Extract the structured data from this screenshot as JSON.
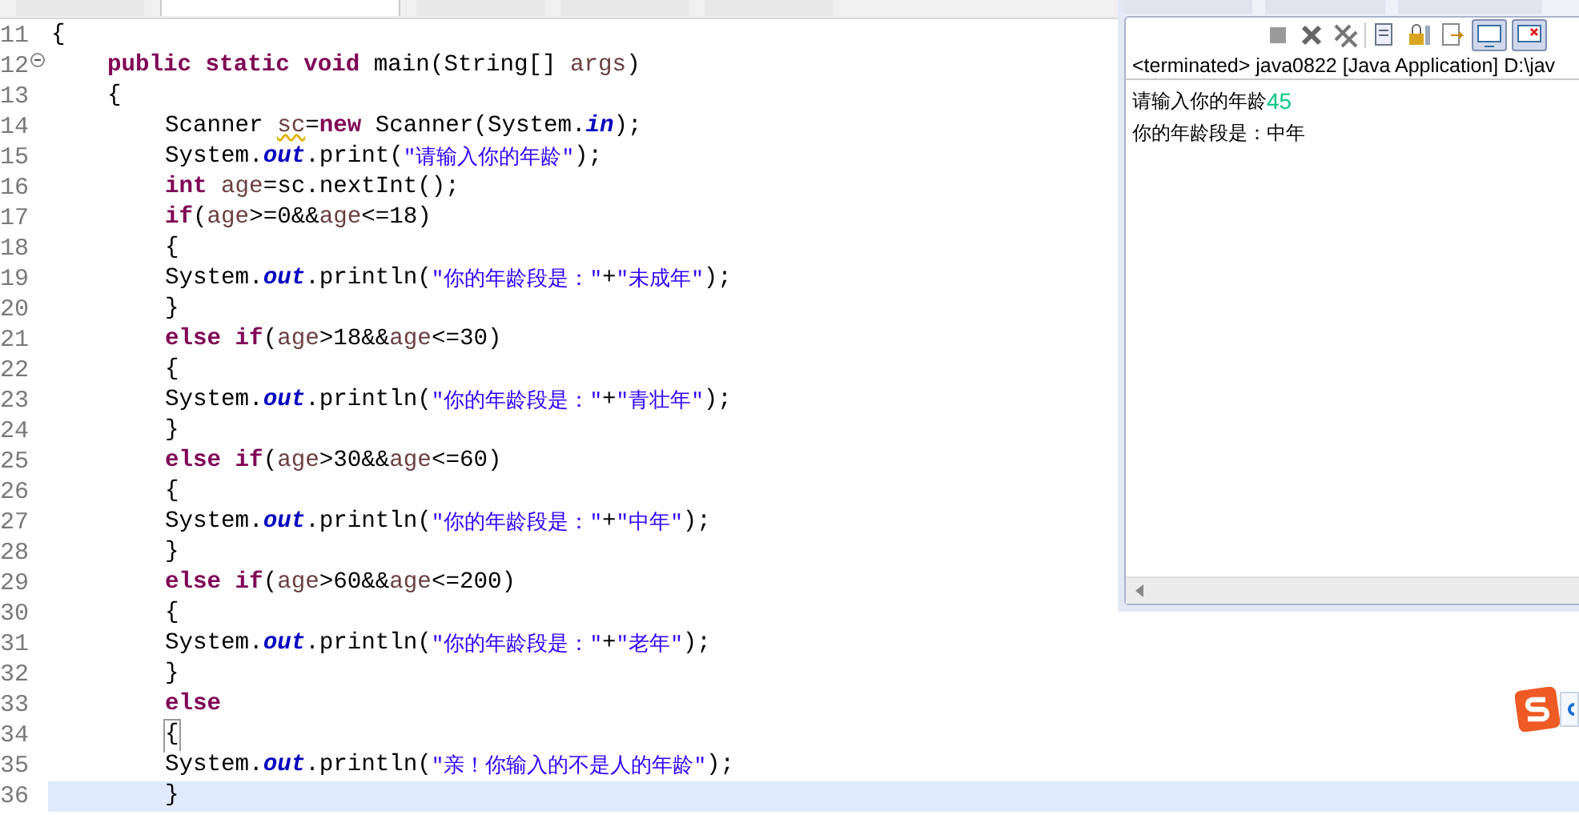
{
  "editor_tabs": [
    {
      "selected": false
    },
    {
      "selected": true
    },
    {
      "selected": false
    },
    {
      "selected": false
    },
    {
      "selected": false
    }
  ],
  "editor": {
    "lines": [
      {
        "num": "11",
        "current": false,
        "fold": false,
        "tokens": [
          {
            "kind": "plain",
            "text": "{"
          }
        ],
        "children": [
          {
            "num": "12",
            "current": false,
            "fold": true,
            "tokens": [
              {
                "kind": "kw",
                "text": "public"
              },
              {
                "kind": "kw",
                "text": " static"
              },
              {
                "kind": "kw",
                "text": " void"
              },
              {
                "kind": "plain",
                "text": " main(String[] "
              },
              {
                "kind": "var",
                "text": "args"
              },
              {
                "kind": "plain",
                "text": ")"
              }
            ]
          },
          {
            "num": "13",
            "current": false,
            "fold": false,
            "tokens": [
              {
                "kind": "plain",
                "text": "{"
              }
            ],
            "children": [
              {
                "num": "14",
                "current": false,
                "fold": false,
                "tokens": [
                  {
                    "kind": "plain",
                    "text": "Scanner "
                  },
                  {
                    "kind": "warn",
                    "text": "sc"
                  },
                  {
                    "kind": "plain",
                    "text": "="
                  },
                  {
                    "kind": "kw",
                    "text": "new"
                  },
                  {
                    "kind": "plain",
                    "text": " Scanner(System."
                  },
                  {
                    "kind": "field",
                    "text": "in"
                  },
                  {
                    "kind": "plain",
                    "text": ");"
                  }
                ]
              },
              {
                "num": "15",
                "current": false,
                "fold": false,
                "tokens": [
                  {
                    "kind": "plain",
                    "text": "System."
                  },
                  {
                    "kind": "field",
                    "text": "out"
                  },
                  {
                    "kind": "plain",
                    "text": ".print("
                  },
                  {
                    "kind": "str",
                    "text": "\"请输入你的年龄\""
                  },
                  {
                    "kind": "plain",
                    "text": ");"
                  }
                ]
              },
              {
                "num": "16",
                "current": false,
                "fold": false,
                "tokens": [
                  {
                    "kind": "kw",
                    "text": "int"
                  },
                  {
                    "kind": "var",
                    "text": " age"
                  },
                  {
                    "kind": "plain",
                    "text": "=sc.nextInt();"
                  }
                ]
              },
              {
                "num": "17",
                "current": false,
                "fold": false,
                "tokens": [
                  {
                    "kind": "kw",
                    "text": "if"
                  },
                  {
                    "kind": "plain",
                    "text": "("
                  },
                  {
                    "kind": "var",
                    "text": "age"
                  },
                  {
                    "kind": "plain",
                    "text": ">=0&&"
                  },
                  {
                    "kind": "var",
                    "text": "age"
                  },
                  {
                    "kind": "plain",
                    "text": "<=18)"
                  }
                ]
              },
              {
                "num": "18",
                "current": false,
                "fold": false,
                "tokens": [
                  {
                    "kind": "plain",
                    "text": "{"
                  }
                ]
              },
              {
                "num": "19",
                "current": false,
                "fold": false,
                "tokens": [
                  {
                    "kind": "plain",
                    "text": "System."
                  },
                  {
                    "kind": "field",
                    "text": "out"
                  },
                  {
                    "kind": "plain",
                    "text": ".println("
                  },
                  {
                    "kind": "str",
                    "text": "\"你的年龄段是：\""
                  },
                  {
                    "kind": "plain",
                    "text": "+"
                  },
                  {
                    "kind": "str",
                    "text": "\"未成年\""
                  },
                  {
                    "kind": "plain",
                    "text": ");"
                  }
                ]
              },
              {
                "num": "20",
                "current": false,
                "fold": false,
                "tokens": [
                  {
                    "kind": "plain",
                    "text": "}"
                  }
                ]
              },
              {
                "num": "21",
                "current": false,
                "fold": false,
                "tokens": [
                  {
                    "kind": "kw",
                    "text": "else"
                  },
                  {
                    "kind": "kw",
                    "text": " if"
                  },
                  {
                    "kind": "plain",
                    "text": "("
                  },
                  {
                    "kind": "var",
                    "text": "age"
                  },
                  {
                    "kind": "plain",
                    "text": ">18&&"
                  },
                  {
                    "kind": "var",
                    "text": "age"
                  },
                  {
                    "kind": "plain",
                    "text": "<=30)"
                  }
                ]
              },
              {
                "num": "22",
                "current": false,
                "fold": false,
                "tokens": [
                  {
                    "kind": "plain",
                    "text": "{"
                  }
                ]
              },
              {
                "num": "23",
                "current": false,
                "fold": false,
                "tokens": [
                  {
                    "kind": "plain",
                    "text": "System."
                  },
                  {
                    "kind": "field",
                    "text": "out"
                  },
                  {
                    "kind": "plain",
                    "text": ".println("
                  },
                  {
                    "kind": "str",
                    "text": "\"你的年龄段是：\""
                  },
                  {
                    "kind": "plain",
                    "text": "+"
                  },
                  {
                    "kind": "str",
                    "text": "\"青壮年\""
                  },
                  {
                    "kind": "plain",
                    "text": ");"
                  }
                ]
              },
              {
                "num": "24",
                "current": false,
                "fold": false,
                "tokens": [
                  {
                    "kind": "plain",
                    "text": "}"
                  }
                ]
              },
              {
                "num": "25",
                "current": false,
                "fold": false,
                "tokens": [
                  {
                    "kind": "kw",
                    "text": "else"
                  },
                  {
                    "kind": "kw",
                    "text": " if"
                  },
                  {
                    "kind": "plain",
                    "text": "("
                  },
                  {
                    "kind": "var",
                    "text": "age"
                  },
                  {
                    "kind": "plain",
                    "text": ">30&&"
                  },
                  {
                    "kind": "var",
                    "text": "age"
                  },
                  {
                    "kind": "plain",
                    "text": "<=60)"
                  }
                ]
              },
              {
                "num": "26",
                "current": false,
                "fold": false,
                "tokens": [
                  {
                    "kind": "plain",
                    "text": "{"
                  }
                ]
              },
              {
                "num": "27",
                "current": false,
                "fold": false,
                "tokens": [
                  {
                    "kind": "plain",
                    "text": "System."
                  },
                  {
                    "kind": "field",
                    "text": "out"
                  },
                  {
                    "kind": "plain",
                    "text": ".println("
                  },
                  {
                    "kind": "str",
                    "text": "\"你的年龄段是：\""
                  },
                  {
                    "kind": "plain",
                    "text": "+"
                  },
                  {
                    "kind": "str",
                    "text": "\"中年\""
                  },
                  {
                    "kind": "plain",
                    "text": ");"
                  }
                ]
              },
              {
                "num": "28",
                "current": false,
                "fold": false,
                "tokens": [
                  {
                    "kind": "plain",
                    "text": "}"
                  }
                ]
              },
              {
                "num": "29",
                "current": false,
                "fold": false,
                "tokens": [
                  {
                    "kind": "kw",
                    "text": "else"
                  },
                  {
                    "kind": "kw",
                    "text": " if"
                  },
                  {
                    "kind": "plain",
                    "text": "("
                  },
                  {
                    "kind": "var",
                    "text": "age"
                  },
                  {
                    "kind": "plain",
                    "text": ">60&&"
                  },
                  {
                    "kind": "var",
                    "text": "age"
                  },
                  {
                    "kind": "plain",
                    "text": "<=200)"
                  }
                ]
              },
              {
                "num": "30",
                "current": false,
                "fold": false,
                "tokens": [
                  {
                    "kind": "plain",
                    "text": "{"
                  }
                ]
              },
              {
                "num": "31",
                "current": false,
                "fold": false,
                "tokens": [
                  {
                    "kind": "plain",
                    "text": "System."
                  },
                  {
                    "kind": "field",
                    "text": "out"
                  },
                  {
                    "kind": "plain",
                    "text": ".println("
                  },
                  {
                    "kind": "str",
                    "text": "\"你的年龄段是：\""
                  },
                  {
                    "kind": "plain",
                    "text": "+"
                  },
                  {
                    "kind": "str",
                    "text": "\"老年\""
                  },
                  {
                    "kind": "plain",
                    "text": ");"
                  }
                ]
              },
              {
                "num": "32",
                "current": false,
                "fold": false,
                "tokens": [
                  {
                    "kind": "plain",
                    "text": "}"
                  }
                ]
              },
              {
                "num": "33",
                "current": false,
                "fold": false,
                "tokens": [
                  {
                    "kind": "kw",
                    "text": "else"
                  }
                ]
              },
              {
                "num": "34",
                "current": false,
                "fold": false,
                "tokens": [
                  {
                    "kind": "bracket",
                    "text": "{"
                  }
                ]
              },
              {
                "num": "35",
                "current": false,
                "fold": false,
                "tokens": [
                  {
                    "kind": "plain",
                    "text": "System."
                  },
                  {
                    "kind": "field",
                    "text": "out"
                  },
                  {
                    "kind": "plain",
                    "text": ".println("
                  },
                  {
                    "kind": "str",
                    "text": "\"亲！你输入的不是人的年龄\""
                  },
                  {
                    "kind": "plain",
                    "text": ");"
                  }
                ]
              },
              {
                "num": "36",
                "current": true,
                "fold": false,
                "tokens": [
                  {
                    "kind": "plain",
                    "text": "}"
                  }
                ]
              }
            ]
          }
        ]
      }
    ]
  },
  "console": {
    "header": "<terminated> java0822 [Java Application] D:\\jav",
    "output": [
      [
        {
          "kind": "out",
          "text": "请输入你的年龄"
        },
        {
          "kind": "in",
          "text": "45"
        }
      ],
      [
        {
          "kind": "out",
          "text": "你的年龄段是：中年"
        }
      ]
    ]
  }
}
